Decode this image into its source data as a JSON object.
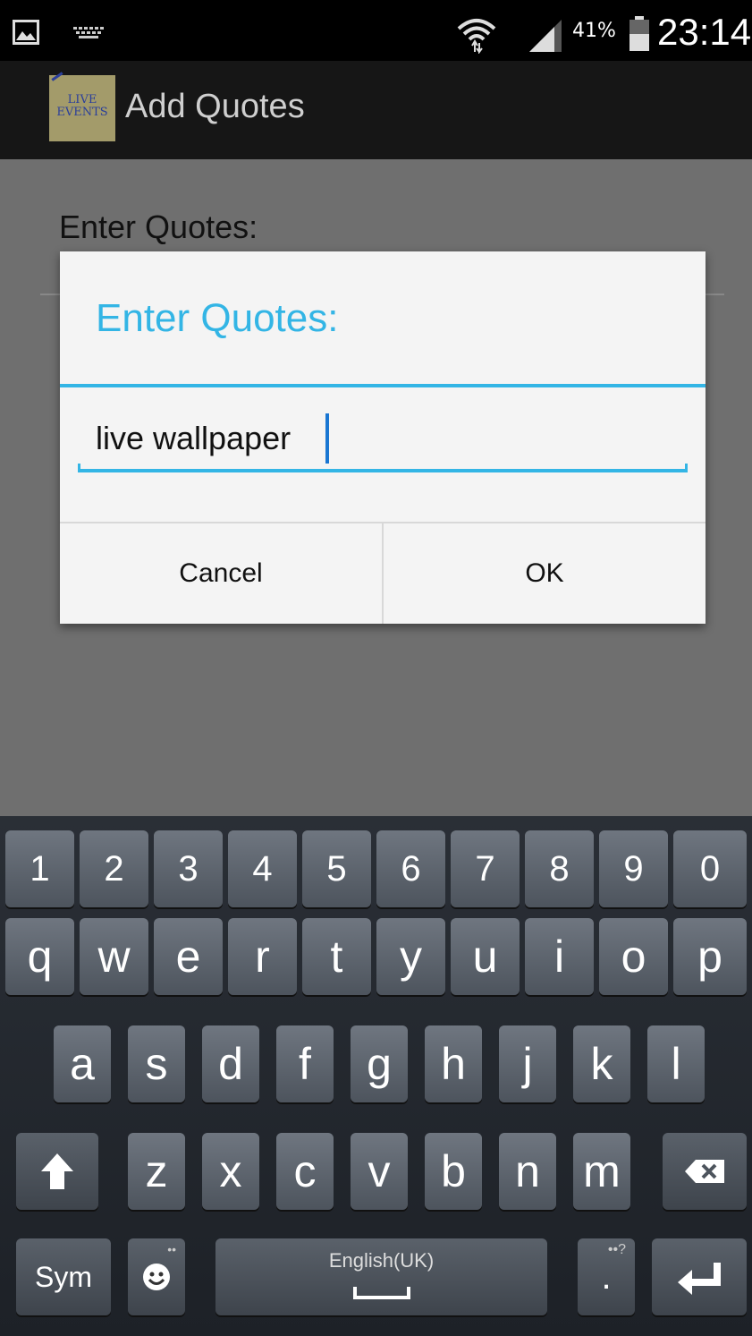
{
  "status": {
    "battery_pct": "41%",
    "time": "23:14"
  },
  "app": {
    "icon_line1": "LIVE",
    "icon_line2": "EVENTS",
    "title": "Add Quotes"
  },
  "background": {
    "label": "Enter Quotes:"
  },
  "dialog": {
    "title": "Enter Quotes:",
    "input_value": "live wallpaper",
    "cancel": "Cancel",
    "ok": "OK"
  },
  "keyboard": {
    "numbers": [
      "1",
      "2",
      "3",
      "4",
      "5",
      "6",
      "7",
      "8",
      "9",
      "0"
    ],
    "row1": [
      "q",
      "w",
      "e",
      "r",
      "t",
      "y",
      "u",
      "i",
      "o",
      "p"
    ],
    "row2": [
      "a",
      "s",
      "d",
      "f",
      "g",
      "h",
      "j",
      "k",
      "l"
    ],
    "row3": [
      "z",
      "x",
      "c",
      "v",
      "b",
      "n",
      "m"
    ],
    "sym": "Sym",
    "space_label": "English(UK)",
    "period": ".",
    "period_sub": "••?"
  },
  "colors": {
    "accent": "#33b5e5",
    "dialog_bg": "#f4f4f4",
    "scrim": "#6f6f6f"
  },
  "icons": [
    "image-icon",
    "keyboard-icon",
    "wifi-icon",
    "signal-icon",
    "battery-icon",
    "shift-icon",
    "backspace-icon",
    "emoji-icon",
    "enter-icon"
  ]
}
